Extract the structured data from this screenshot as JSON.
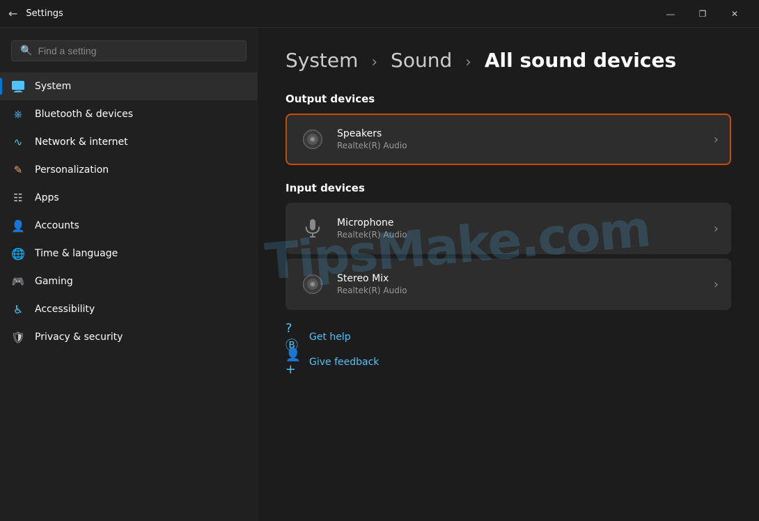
{
  "titleBar": {
    "title": "Settings",
    "controls": {
      "minimize": "—",
      "maximize": "❐",
      "close": "✕"
    }
  },
  "sidebar": {
    "search": {
      "placeholder": "Find a setting"
    },
    "navItems": [
      {
        "id": "system",
        "label": "System",
        "icon": "monitor",
        "active": true
      },
      {
        "id": "bluetooth",
        "label": "Bluetooth & devices",
        "icon": "bluetooth",
        "active": false
      },
      {
        "id": "network",
        "label": "Network & internet",
        "icon": "network",
        "active": false
      },
      {
        "id": "personalization",
        "label": "Personalization",
        "icon": "personalization",
        "active": false
      },
      {
        "id": "apps",
        "label": "Apps",
        "icon": "apps",
        "active": false
      },
      {
        "id": "accounts",
        "label": "Accounts",
        "icon": "accounts",
        "active": false
      },
      {
        "id": "time",
        "label": "Time & language",
        "icon": "time",
        "active": false
      },
      {
        "id": "gaming",
        "label": "Gaming",
        "icon": "gaming",
        "active": false
      },
      {
        "id": "accessibility",
        "label": "Accessibility",
        "icon": "accessibility",
        "active": false
      },
      {
        "id": "privacy",
        "label": "Privacy & security",
        "icon": "privacy",
        "active": false
      }
    ]
  },
  "main": {
    "breadcrumb": {
      "system": "System",
      "separator1": "›",
      "sound": "Sound",
      "separator2": "›",
      "current": "All sound devices"
    },
    "outputDevices": {
      "sectionTitle": "Output devices",
      "devices": [
        {
          "name": "Speakers",
          "sub": "Realtek(R) Audio",
          "highlighted": true
        }
      ]
    },
    "inputDevices": {
      "sectionTitle": "Input devices",
      "devices": [
        {
          "name": "Microphone",
          "sub": "Realtek(R) Audio",
          "highlighted": false
        },
        {
          "name": "Stereo Mix",
          "sub": "Realtek(R) Audio",
          "highlighted": false
        }
      ]
    },
    "helpLinks": [
      {
        "id": "get-help",
        "label": "Get help"
      },
      {
        "id": "give-feedback",
        "label": "Give feedback"
      }
    ]
  }
}
